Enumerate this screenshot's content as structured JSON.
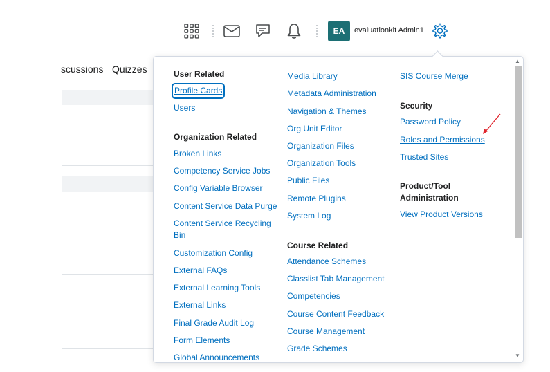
{
  "header": {
    "user": {
      "initials": "EA",
      "name": "evaluationkit Admin1",
      "avatar_color": "#1c6f74"
    },
    "icons": [
      "apps-grid-icon",
      "mail-icon",
      "chat-icon",
      "bell-icon",
      "gear-icon"
    ]
  },
  "course_nav": {
    "items": [
      "scussions",
      "Quizzes"
    ]
  },
  "admin_menu": {
    "col1": {
      "user_related": {
        "heading": "User Related",
        "items": [
          "Profile Cards",
          "Users"
        ]
      },
      "org_related": {
        "heading": "Organization Related",
        "items": [
          "Broken Links",
          "Competency Service Jobs",
          "Config Variable Browser",
          "Content Service Data Purge",
          "Content Service Recycling Bin",
          "Customization Config",
          "External FAQs",
          "External Learning Tools",
          "External Links",
          "Final Grade Audit Log",
          "Form Elements",
          "Global Announcements"
        ]
      }
    },
    "col2": {
      "items": [
        "Media Library",
        "Metadata Administration",
        "Navigation & Themes",
        "Org Unit Editor",
        "Organization Files",
        "Organization Tools",
        "Public Files",
        "Remote Plugins",
        "System Log"
      ],
      "course_related": {
        "heading": "Course Related",
        "items": [
          "Attendance Schemes",
          "Classlist Tab Management",
          "Competencies",
          "Course Content Feedback",
          "Course Management",
          "Grade Schemes"
        ]
      }
    },
    "col3": {
      "items": [
        "SIS Course Merge"
      ],
      "security": {
        "heading": "Security",
        "items": [
          "Password Policy",
          "Roles and Permissions",
          "Trusted Sites"
        ]
      },
      "product": {
        "heading": "Product/Tool Administration",
        "items": [
          "View Product Versions"
        ]
      }
    }
  },
  "colors": {
    "link": "#006fbf",
    "annotation_arrow": "#e0232b"
  }
}
